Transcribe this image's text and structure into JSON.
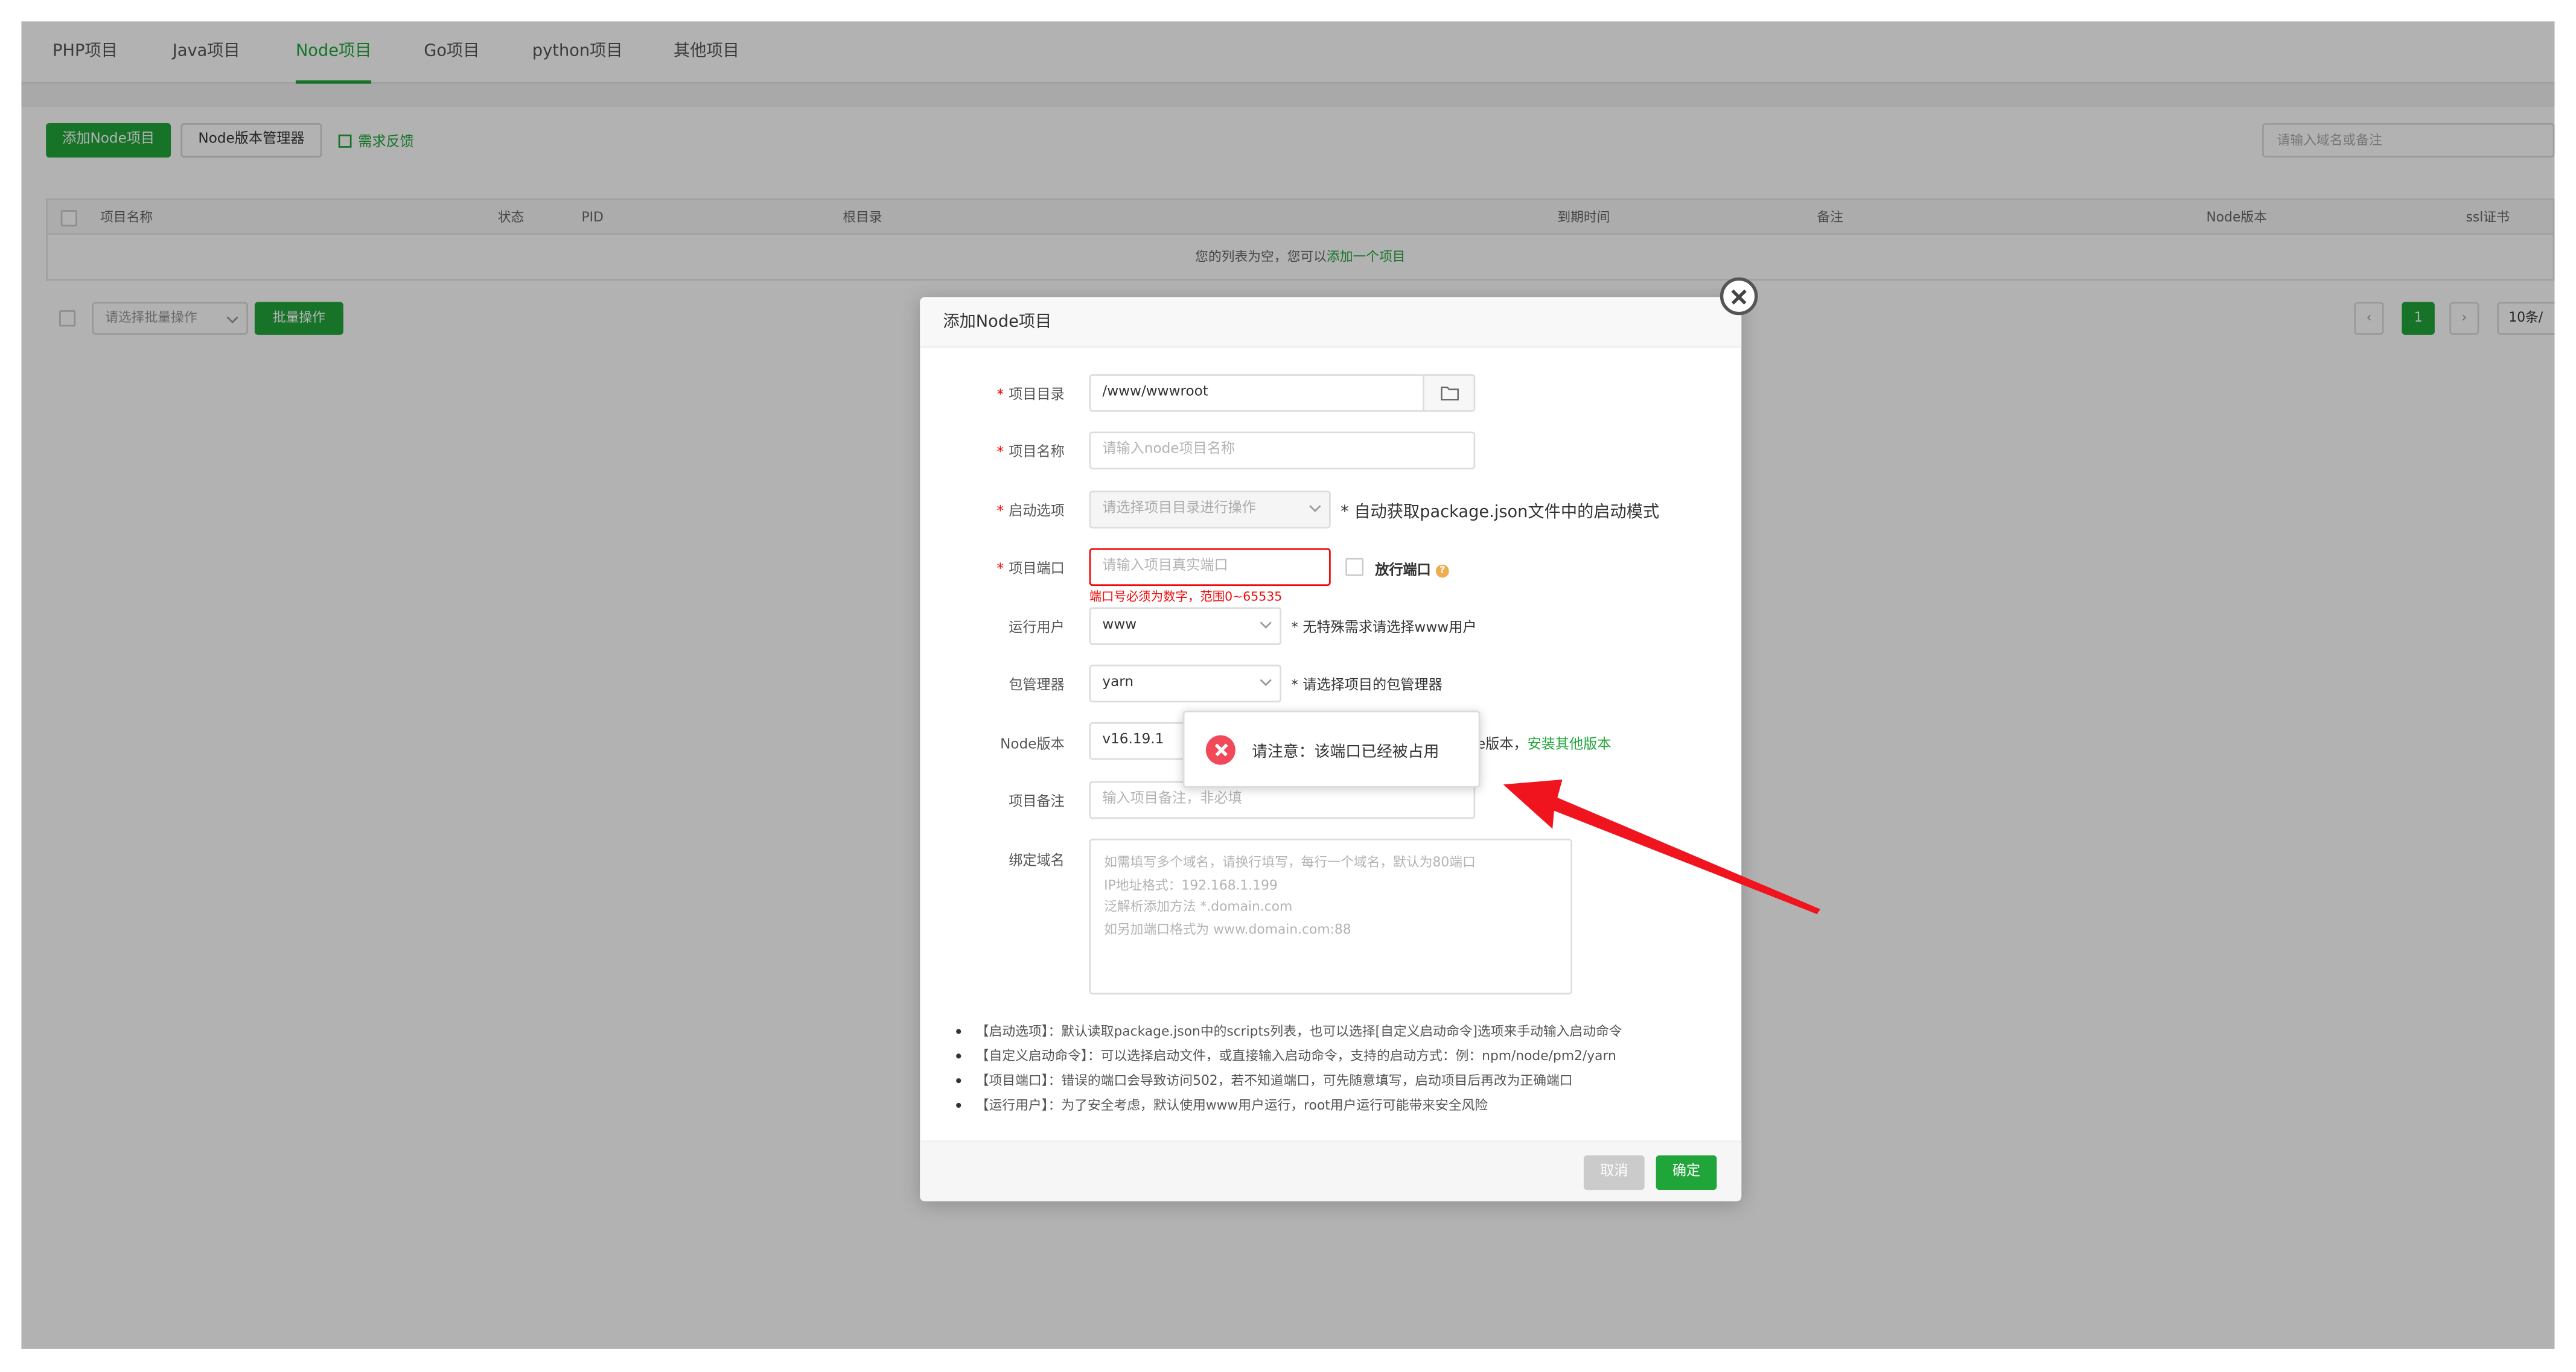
{
  "tabs": [
    "PHP项目",
    "Java项目",
    "Node项目",
    "Go项目",
    "python项目",
    "其他项目"
  ],
  "active_tab_index": 2,
  "toolbar": {
    "add_button": "添加Node项目",
    "version_manager_button": "Node版本管理器",
    "feedback_link": "需求反馈",
    "search_placeholder": "请输入域名或备注"
  },
  "table": {
    "columns": [
      "项目名称",
      "状态",
      "PID",
      "根目录",
      "到期时间",
      "备注",
      "Node版本",
      "ssl证书"
    ],
    "empty_text": "您的列表为空，您可以",
    "empty_link": "添加一个项目"
  },
  "bottom": {
    "batch_placeholder": "请选择批量操作",
    "batch_button": "批量操作",
    "current_page": "1",
    "page_size": "10条/"
  },
  "modal": {
    "title": "添加Node项目",
    "fields": {
      "dir_label": "项目目录",
      "dir_value": "/www/wwwroot",
      "name_label": "项目名称",
      "name_placeholder": "请输入node项目名称",
      "start_label": "启动选项",
      "start_placeholder": "请选择项目目录进行操作",
      "start_hint": "* 自动获取package.json文件中的启动模式",
      "port_label": "项目端口",
      "port_placeholder": "请输入项目真实端口",
      "port_error": "端口号必须为数字，范围0~65535",
      "port_release_label": "放行端口",
      "user_label": "运行用户",
      "user_value": "www",
      "user_hint": "* 无特殊需求请选择www用户",
      "pm_label": "包管理器",
      "pm_value": "yarn",
      "pm_hint": "* 请选择项目的包管理器",
      "node_label": "Node版本",
      "node_value": "v16.19.1",
      "node_hint_tail": "e版本，",
      "node_hint_link": "安装其他版本",
      "remark_label": "项目备注",
      "remark_placeholder": "输入项目备注，非必填",
      "domain_label": "绑定域名",
      "domain_placeholder_lines": [
        "如需填写多个域名，请换行填写，每行一个域名，默认为80端口",
        "IP地址格式：192.168.1.199",
        "泛解析添加方法 *.domain.com",
        "如另加端口格式为 www.domain.com:88"
      ]
    },
    "notes": [
      "【启动选项】：默认读取package.json中的scripts列表，也可以选择[自定义启动命令]选项来手动输入启动命令",
      "【自定义启动命令】：可以选择启动文件，或直接输入启动命令，支持的启动方式：例：npm/node/pm2/yarn",
      "【项目端口】：错误的端口会导致访问502，若不知道端口，可先随意填写，启动项目后再改为正确端口",
      "【运行用户】：为了安全考虑，默认使用www用户运行，root用户运行可能带来安全风险"
    ],
    "cancel_button": "取消",
    "ok_button": "确定"
  },
  "toast": {
    "message": "请注意：该端口已经被占用"
  },
  "colors": {
    "accent": "#20a53a",
    "error": "#ef0808",
    "toast_icon": "#f1495a",
    "annotation_arrow": "#f0141e"
  }
}
